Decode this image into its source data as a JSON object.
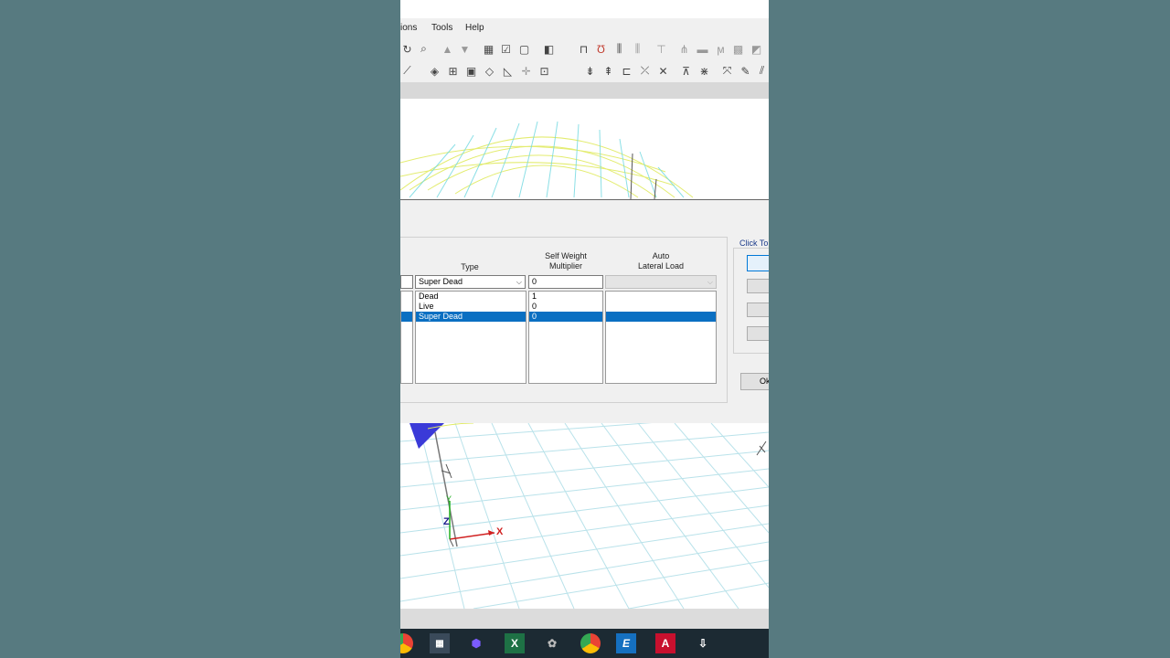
{
  "menu": {
    "items": [
      {
        "label": "ions"
      },
      {
        "label": "Tools"
      },
      {
        "label": "Help"
      }
    ]
  },
  "dialog": {
    "click_to_label": "Click To",
    "ok_label": "Ok",
    "columns": {
      "type": "Type",
      "self_weight": "Self Weight\nMultiplier",
      "auto_lateral": "Auto\nLateral Load"
    },
    "edit": {
      "type": "Super Dead",
      "self_weight": "0"
    },
    "rows": [
      {
        "type": "Dead",
        "multiplier": "1",
        "selected": false
      },
      {
        "type": "Live",
        "multiplier": "0",
        "selected": false
      },
      {
        "type": "Super Dead",
        "multiplier": "0",
        "selected": true
      }
    ]
  },
  "axes": {
    "x": "X",
    "y": "Y",
    "z": "Z"
  },
  "taskbar": {
    "excel_letter": "X",
    "etabs_letter": "E",
    "autocad_letter": "A"
  },
  "colors": {
    "selection": "#0a6fc2",
    "background": "#577a80",
    "taskbar": "#1c2a33"
  }
}
